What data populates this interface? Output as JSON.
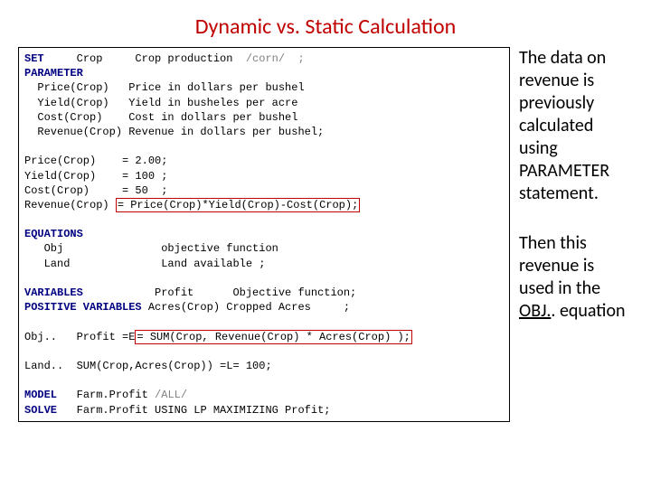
{
  "title": "Dynamic vs. Static Calculation",
  "code": {
    "kw_set": "SET",
    "set_line": "     Crop     Crop production  ",
    "set_comment": "/corn/  ;",
    "kw_param": "PARAMETER",
    "p_price": "  Price(Crop)   Price in dollars per bushel",
    "p_yield": "  Yield(Crop)   Yield in busheles per acre",
    "p_cost": "  Cost(Crop)    Cost in dollars per bushel",
    "p_rev": "  Revenue(Crop) Revenue in dollars per bushel;",
    "a_price": "Price(Crop)    = 2.00;",
    "a_yield": "Yield(Crop)    = 100 ;",
    "a_cost": "Cost(Crop)     = 50  ;",
    "a_rev_l": "Revenue(Crop) ",
    "a_rev_r": "= Price(Crop)*Yield(Crop)-Cost(Crop);",
    "kw_eq": "EQUATIONS",
    "eq_obj": "   Obj               objective function",
    "eq_land": "   Land              Land available ;",
    "kw_var": "VARIABLES",
    "var_line": "           Profit      Objective function;",
    "kw_posvar": "POSITIVE VARIABLES",
    "posvar_line": " Acres(Crop) Cropped Acres     ;",
    "obj_l": "Obj..   Profit =E",
    "obj_r": "= SUM(Crop, Revenue(Crop) * Acres(Crop) );",
    "land_line": "Land..  SUM(Crop,Acres(Crop)) =L= 100;",
    "kw_model": "MODEL",
    "model_line": "   Farm.Profit ",
    "model_comment": "/ALL/",
    "kw_solve": "SOLVE",
    "solve_line": "   Farm.Profit USING LP MAXIMIZING Profit;"
  },
  "side": {
    "p1": "The data on revenue is previously calculated using PARAMETER statement.",
    "p2a": "Then this revenue is used in the ",
    "p2b": "OBJ.",
    "p2c": ". equation"
  }
}
